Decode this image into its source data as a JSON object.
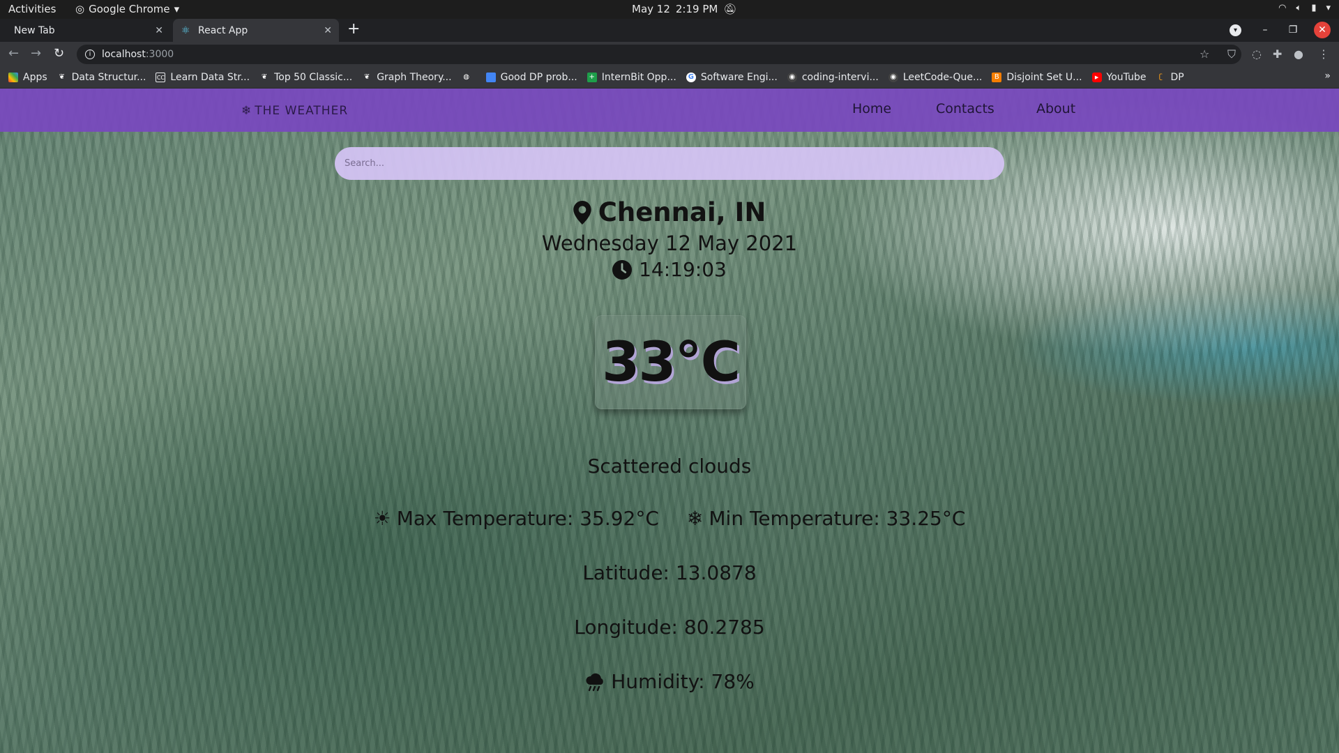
{
  "os": {
    "activities": "Activities",
    "app": "Google Chrome",
    "date": "May 12",
    "time": "2:19 PM"
  },
  "browser": {
    "tabs": [
      {
        "label": "New Tab"
      },
      {
        "label": "React App"
      }
    ],
    "url_host": "localhost",
    "url_port": ":3000",
    "bookmarks": [
      {
        "label": "Apps",
        "icon": "apps-grid-icon"
      },
      {
        "label": "Data Structur...",
        "icon": "bookmark-icon"
      },
      {
        "label": "Learn Data Str...",
        "icon": "cc-icon"
      },
      {
        "label": "Top 50 Classic...",
        "icon": "bookmark-icon"
      },
      {
        "label": "Graph Theory...",
        "icon": "bookmark-icon"
      },
      {
        "label": "",
        "icon": "globe-icon"
      },
      {
        "label": "Good DP prob...",
        "icon": "bar-icon"
      },
      {
        "label": "InternBit Opp...",
        "icon": "plus-icon"
      },
      {
        "label": "Software Engi...",
        "icon": "google-icon"
      },
      {
        "label": "coding-intervi...",
        "icon": "github-icon"
      },
      {
        "label": "LeetCode-Que...",
        "icon": "github-icon"
      },
      {
        "label": "Disjoint Set U...",
        "icon": "blogger-icon"
      },
      {
        "label": "YouTube",
        "icon": "youtube-icon"
      },
      {
        "label": "DP",
        "icon": "leetcode-icon"
      }
    ]
  },
  "app": {
    "brand": "THE WEATHER",
    "nav": {
      "home": "Home",
      "contacts": "Contacts",
      "about": "About"
    },
    "search_placeholder": "Search...",
    "city": "Chennai, IN",
    "date": "Wednesday 12 May 2021",
    "time": "14:19:03",
    "temp": "33°C",
    "description": "Scattered clouds",
    "max_temp": "Max Temperature: 35.92°C",
    "min_temp": "Min Temperature: 33.25°C",
    "latitude": "Latitude: 13.0878",
    "longitude": "Longitude: 80.2785",
    "humidity": "Humidity: 78%"
  },
  "colors": {
    "navbar": "#7848be",
    "search": "#d5c4f5"
  }
}
